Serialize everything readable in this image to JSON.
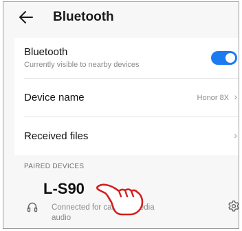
{
  "header": {
    "title": "Bluetooth"
  },
  "settings": {
    "bluetooth_label": "Bluetooth",
    "bluetooth_sub": "Currently visible to nearby devices",
    "bluetooth_enabled": true,
    "device_name_label": "Device name",
    "device_name_value": "Honor 8X",
    "received_files_label": "Received files",
    "chevron": "›"
  },
  "paired": {
    "section_label": "PAIRED DEVICES",
    "device_name": "L-S90",
    "status_line1": "Connected for call and media",
    "status_line2": "audio"
  },
  "colors": {
    "accent": "#1a7cf0"
  },
  "icons": [
    "back-arrow-icon",
    "headphone-icon",
    "gear-icon",
    "pointing-hand-icon"
  ]
}
